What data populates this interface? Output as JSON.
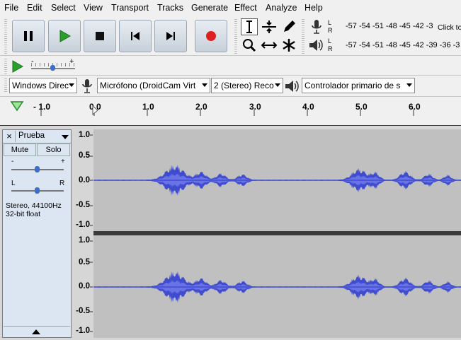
{
  "menu": [
    "File",
    "Edit",
    "Select",
    "View",
    "Transport",
    "Tracks",
    "Generate",
    "Effect",
    "Analyze",
    "Help"
  ],
  "meters": {
    "record_scale": "-57 -54 -51 -48 -45 -42 -3",
    "record_hint": "Click to",
    "playback_scale": "-57 -54 -51 -48 -45 -42 -39 -36 -3",
    "left": "L",
    "right": "R"
  },
  "slider": {
    "minus": "-",
    "plus": "+",
    "level": 0.55
  },
  "device": {
    "host": "Windows Direc",
    "input": "Micrófono (DroidCam Virt",
    "channels": "2 (Stereo) Reco",
    "output": "Controlador primario de s"
  },
  "ruler": {
    "labels": [
      "- 1.0",
      "0.0",
      "1.0",
      "2.0",
      "3.0",
      "4.0",
      "5.0",
      "6.0"
    ]
  },
  "track": {
    "name": "Prueba",
    "close": "×",
    "mute": "Mute",
    "solo": "Solo",
    "gain_minus": "-",
    "gain_plus": "+",
    "pan_left": "L",
    "pan_right": "R",
    "info_line1": "Stereo, 44100Hz",
    "info_line2": "32-bit float",
    "vscale": [
      "1.0",
      "0.5",
      "0.0",
      "-0.5",
      "-1.0"
    ]
  },
  "colors": {
    "waveform": "#3f4ccf",
    "waveform_rms": "#6a73e6",
    "track_bg": "#c0c0c0",
    "record_red": "#e02020",
    "play_green": "#2aa02a"
  }
}
